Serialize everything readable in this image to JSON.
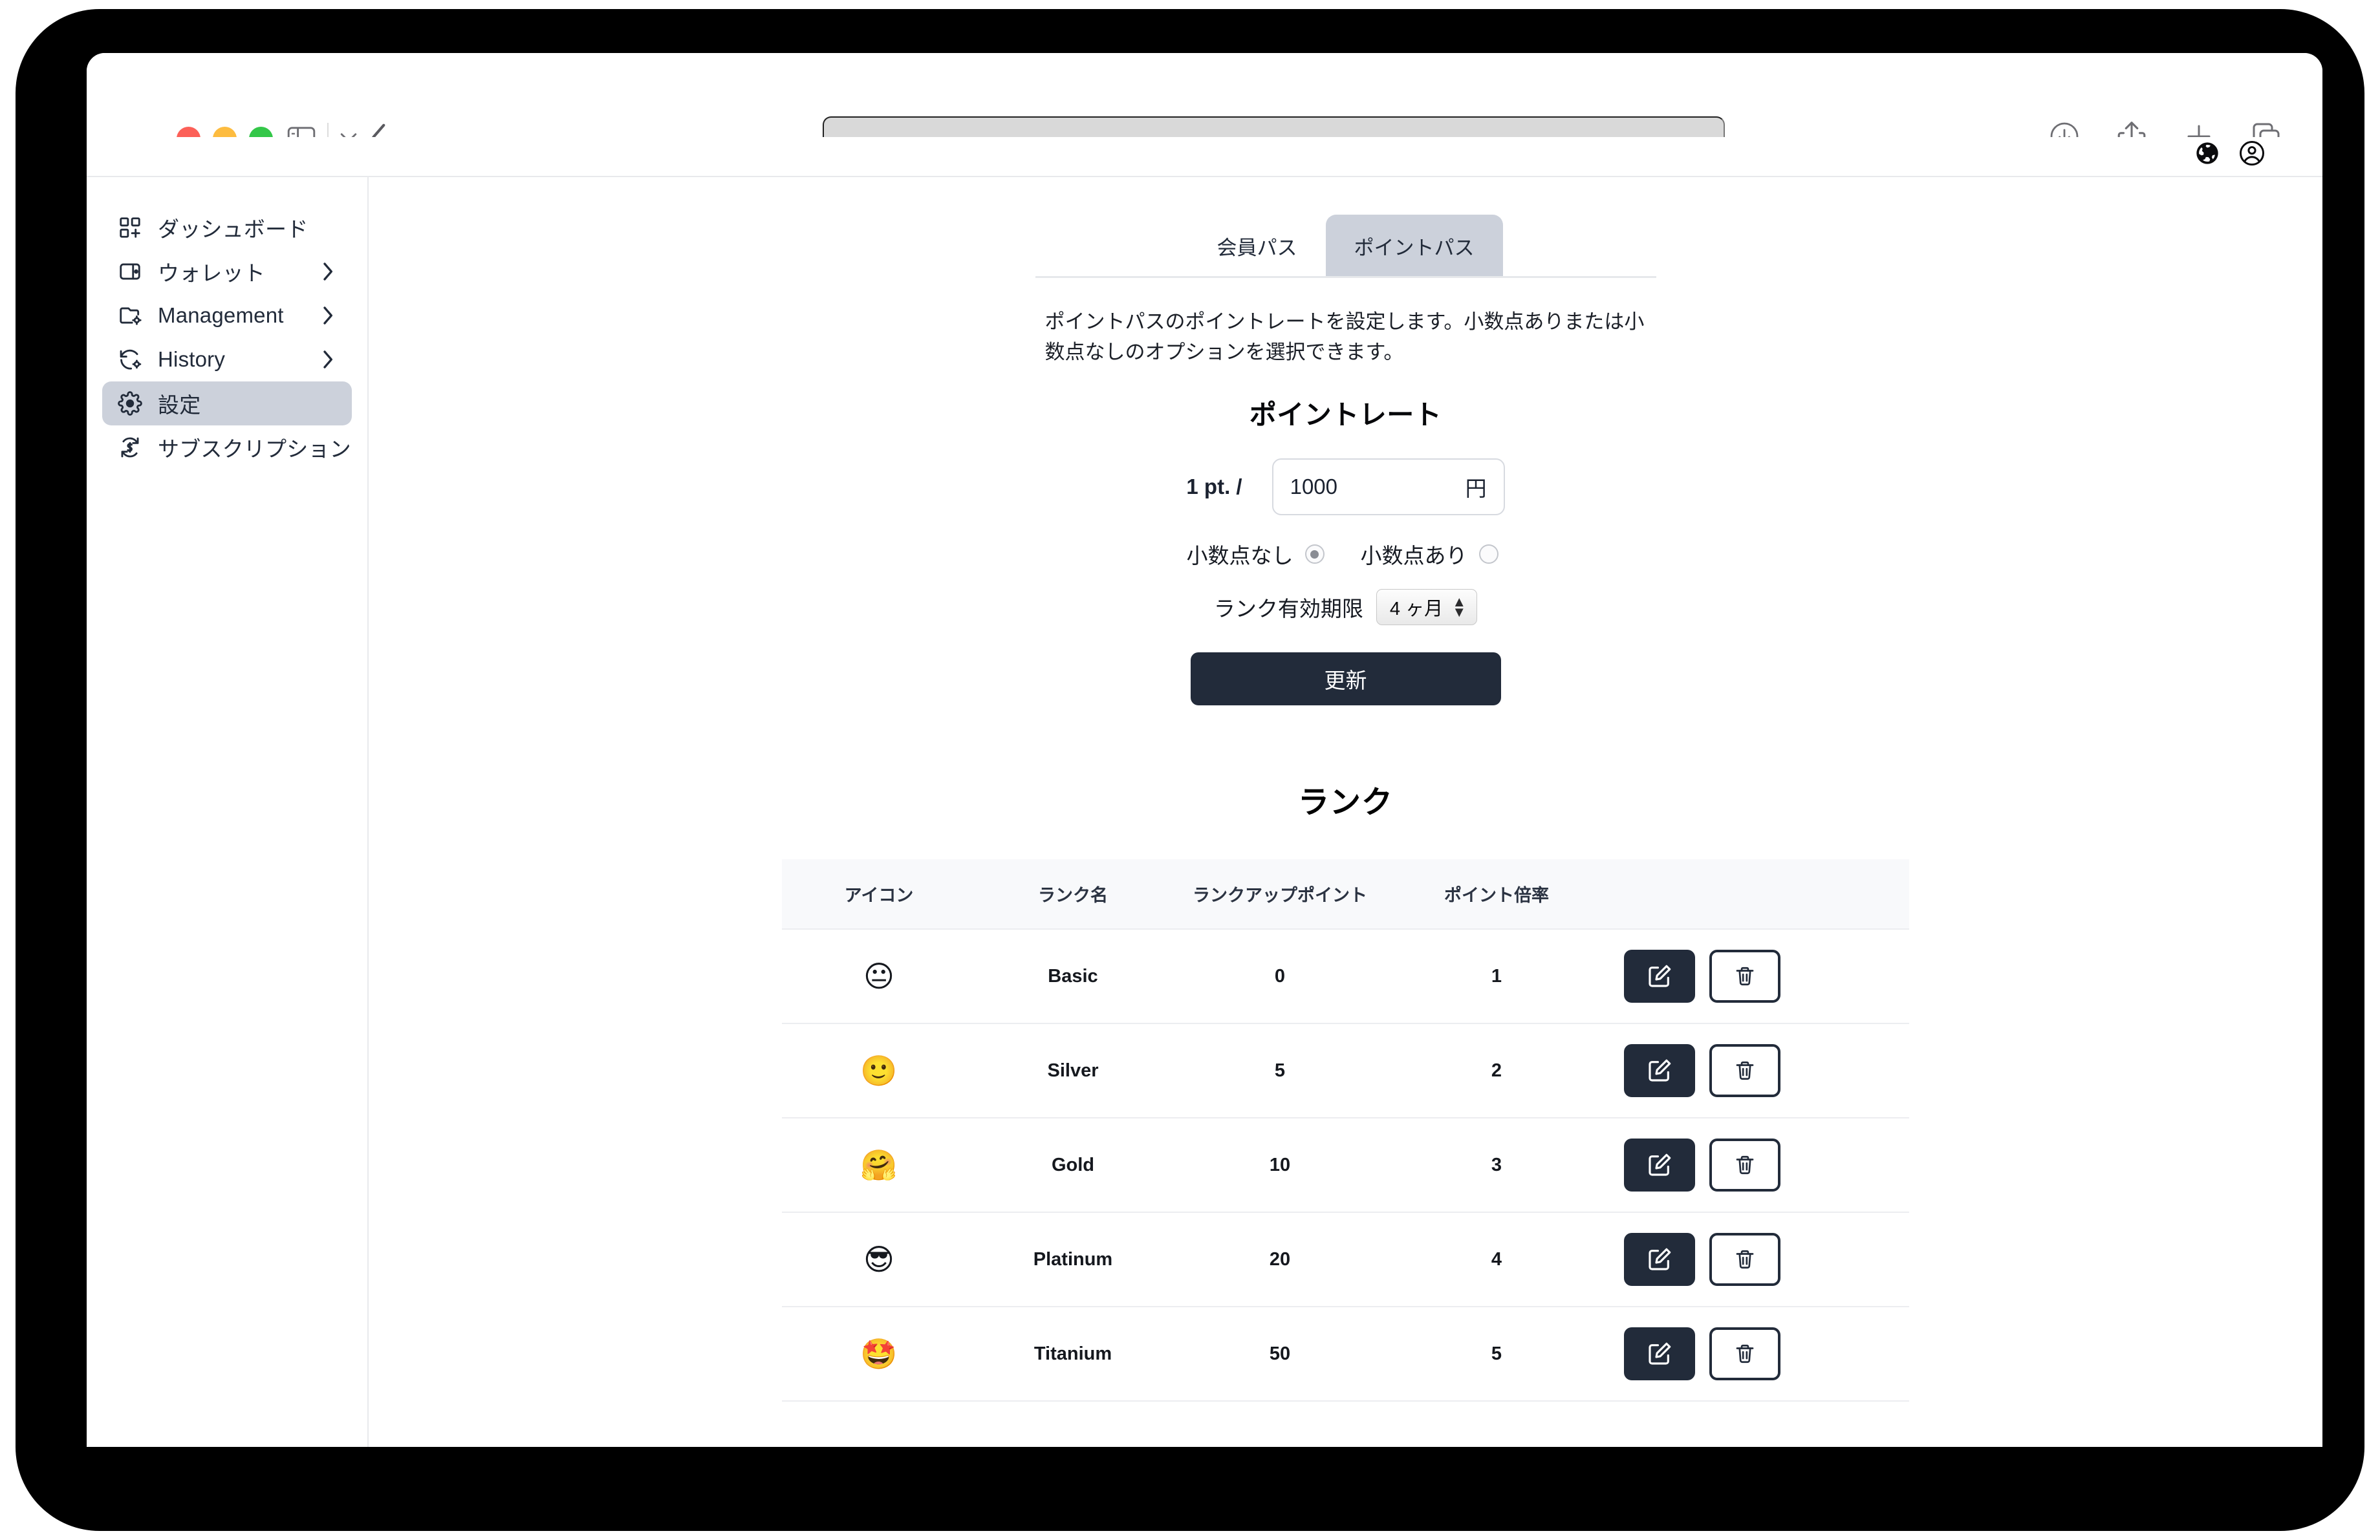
{
  "browser": {
    "traffic_lights": [
      "close",
      "minimize",
      "maximize"
    ],
    "sidebar_toggle_icon": "sidebar-icon",
    "sidebar_chevron_icon": "chevron-down-icon",
    "back_icon": "chevron-left-icon",
    "address_bar_value": "",
    "address_bar_placeholder": "",
    "right_icons": [
      "download-icon",
      "share-icon",
      "plus-icon",
      "tabs-icon"
    ]
  },
  "app_header": {
    "icons": [
      "globe-icon",
      "account-circle-icon"
    ]
  },
  "sidebar": {
    "items": [
      {
        "label": "ダッシュボード",
        "icon": "dashboard-icon",
        "has_chevron": false,
        "active": false
      },
      {
        "label": "ウォレット",
        "icon": "wallet-icon",
        "has_chevron": true,
        "active": false
      },
      {
        "label": "Management",
        "icon": "folder-settings-icon",
        "has_chevron": true,
        "active": false
      },
      {
        "label": "History",
        "icon": "history-settings-icon",
        "has_chevron": true,
        "active": false
      },
      {
        "label": "設定",
        "icon": "gear-icon",
        "has_chevron": false,
        "active": true
      },
      {
        "label": "サブスクリプション",
        "icon": "subscription-icon",
        "has_chevron": false,
        "active": false
      }
    ]
  },
  "main": {
    "tabs": [
      {
        "label": "会員パス",
        "active": false
      },
      {
        "label": "ポイントパス",
        "active": true
      }
    ],
    "intro": "ポイントパスのポイントレートを設定します。小数点ありまたは小数点なしのオプションを選択できます。",
    "point_rate": {
      "title": "ポイントレート",
      "prefix_label": "1 pt. /",
      "value": "1000",
      "placeholder": "",
      "unit": "円",
      "radios": [
        {
          "label": "小数点なし",
          "checked": true
        },
        {
          "label": "小数点あり",
          "checked": false
        }
      ],
      "expiry_label": "ランク有効期限",
      "expiry_value": "4 ヶ月",
      "update_label": "更新"
    },
    "rank": {
      "title": "ランク",
      "columns": [
        "アイコン",
        "ランク名",
        "ランクアップポイント",
        "ポイント倍率",
        ""
      ],
      "rows": [
        {
          "icon": "😐",
          "name": "Basic",
          "rankup_points": "0",
          "multiplier": "1"
        },
        {
          "icon": "🙂",
          "name": "Silver",
          "rankup_points": "5",
          "multiplier": "2"
        },
        {
          "icon": "🤗",
          "name": "Gold",
          "rankup_points": "10",
          "multiplier": "3"
        },
        {
          "icon": "😎",
          "name": "Platinum",
          "rankup_points": "20",
          "multiplier": "4"
        },
        {
          "icon": "🤩",
          "name": "Titanium",
          "rankup_points": "50",
          "multiplier": "5"
        }
      ],
      "edit_icon": "edit-square-icon",
      "delete_icon": "trash-icon"
    }
  },
  "colors": {
    "accent_dark": "#222b3a",
    "active_tab_bg": "#ccd1db",
    "table_header_bg": "#f8f9fb",
    "border": "#ecedf0"
  }
}
